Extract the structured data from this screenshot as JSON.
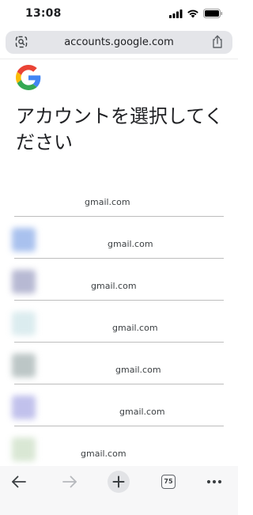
{
  "status_bar": {
    "time": "13:08"
  },
  "address_bar": {
    "url": "accounts.google.com",
    "left_icon": "tune-icon",
    "right_icon": "share-icon"
  },
  "logo": {
    "name": "google-logo",
    "colors": {
      "blue": "#4285F4",
      "red": "#EA4335",
      "yellow": "#FBBC05",
      "green": "#34A853"
    }
  },
  "heading": {
    "title": "アカウントを選択してください"
  },
  "accounts": [
    {
      "email": "gmail.com",
      "avatar_color": ""
    },
    {
      "email": "gmail.com",
      "avatar_color": "#a9c1ee"
    },
    {
      "email": "gmail.com",
      "avatar_color": "#b7b9d3"
    },
    {
      "email": "gmail.com",
      "avatar_color": "#dbecef"
    },
    {
      "email": "gmail.com",
      "avatar_color": "#bcc6c6"
    },
    {
      "email": "gmail.com",
      "avatar_color": "#c1c1ec"
    },
    {
      "email": "gmail.com",
      "avatar_color": "#d9e7d4"
    }
  ],
  "bottom_toolbar": {
    "tab_count": "75",
    "items": [
      "back-icon",
      "forward-icon",
      "new-tab-icon",
      "tabs-icon",
      "more-icon"
    ]
  }
}
